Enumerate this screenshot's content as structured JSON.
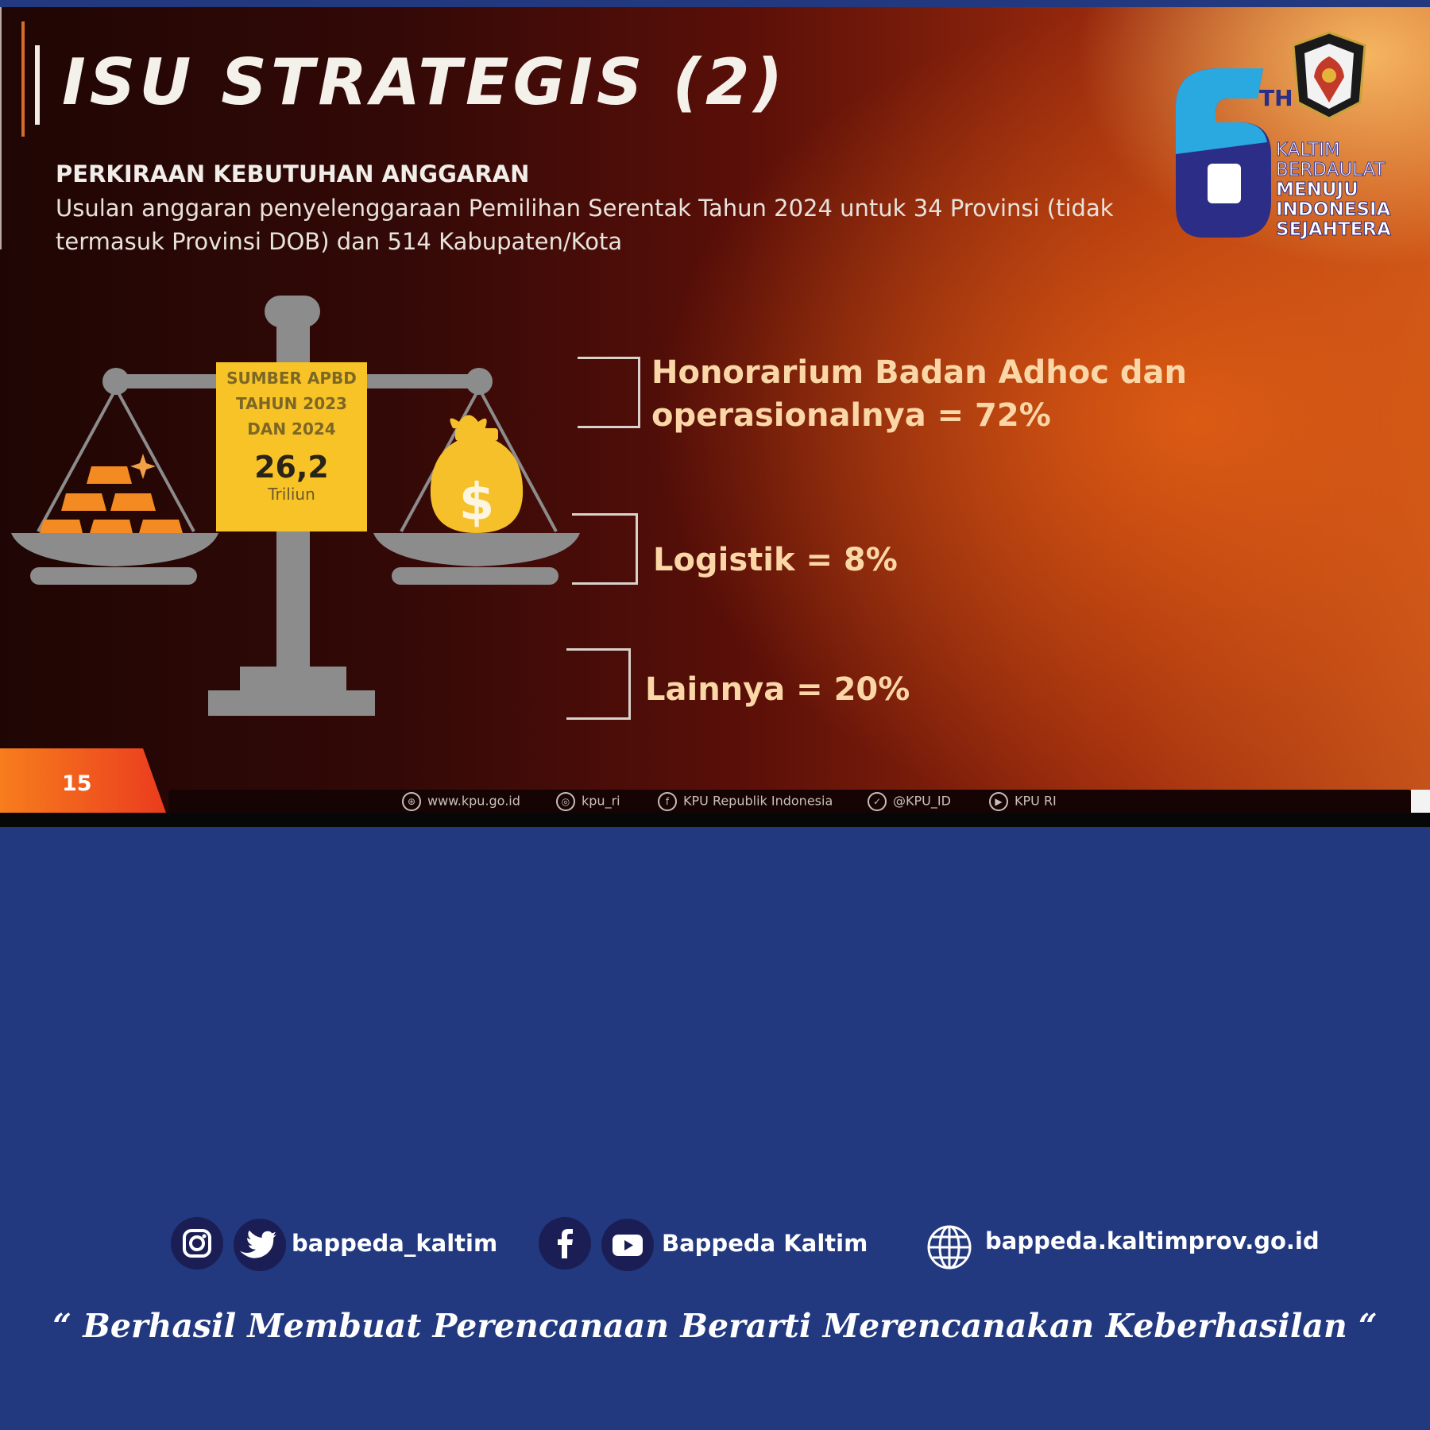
{
  "slide": {
    "title": "ISU STRATEGIS (2)",
    "subheading": "PERKIRAAN KEBUTUHAN ANGGARAN",
    "description": "Usulan anggaran penyelenggaraan Pemilihan Serentak Tahun 2024 untuk 34 Provinsi (tidak termasuk Provinsi DOB) dan 514 Kabupaten/Kota",
    "source_box": {
      "label": "SUMBER APBD\nTAHUN 2023\nDAN 2024",
      "value": "26,2",
      "unit": "Triliun"
    },
    "items": [
      {
        "line1": "Honorarium Badan Adhoc dan",
        "line2": "operasionalnya = 72%"
      },
      {
        "line1": "Logistik = 8%"
      },
      {
        "line1": "Lainnya = 20%"
      }
    ],
    "page_number": "15",
    "footer_links": [
      {
        "icon": "globe-icon",
        "text": "www.kpu.go.id"
      },
      {
        "icon": "instagram-icon",
        "text": "kpu_ri"
      },
      {
        "icon": "facebook-icon",
        "text": "KPU Republik Indonesia"
      },
      {
        "icon": "twitter-icon",
        "text": "@KPU_ID"
      },
      {
        "icon": "youtube-icon",
        "text": "KPU RI"
      }
    ]
  },
  "anniversary_logo": {
    "number": "6",
    "suffix": "TH",
    "lines": [
      "KALTIM",
      "BERDAULAT",
      "MENUJU",
      "INDONESIA",
      "SEJAHTERA"
    ]
  },
  "social": {
    "handle_1": "bappeda_kaltim",
    "handle_2": "Bappeda Kaltim",
    "website": "bappeda.kaltimprov.go.id"
  },
  "quote": "“ Berhasil  Membuat Perencanaan Berarti Merencanakan Keberhasilan “",
  "colors": {
    "background": "#22387f",
    "accent_yellow": "#f7c326",
    "slide_red": "#5a0f08",
    "item_text": "#fbd7a7"
  }
}
